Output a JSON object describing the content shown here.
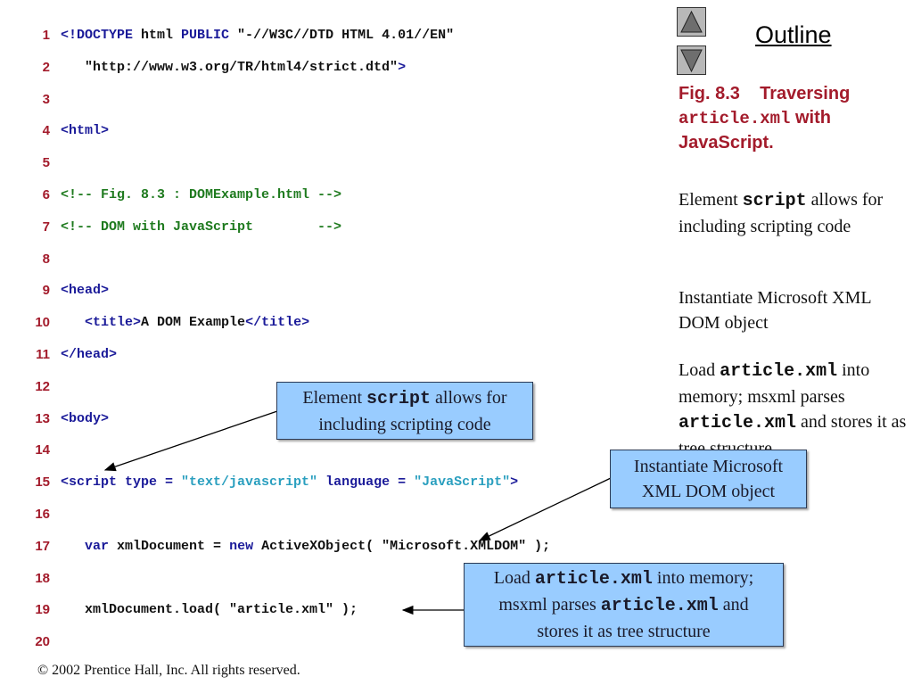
{
  "code_lines": [
    {
      "num": "1",
      "tokens": [
        {
          "cls": "t-tag",
          "text": "<!DOCTYPE"
        },
        {
          "cls": "t-txt",
          "text": " html "
        },
        {
          "cls": "t-tag",
          "text": "PUBLIC"
        },
        {
          "cls": "t-txt",
          "text": " \"-//W3C//DTD HTML 4.01//EN\""
        }
      ]
    },
    {
      "num": "2",
      "tokens": [
        {
          "cls": "t-txt",
          "text": "   \"http://www.w3.org/TR/html4/strict.dtd\""
        },
        {
          "cls": "t-tag",
          "text": ">"
        }
      ]
    },
    {
      "num": "3",
      "tokens": []
    },
    {
      "num": "4",
      "tokens": [
        {
          "cls": "t-tag",
          "text": "<html>"
        }
      ]
    },
    {
      "num": "5",
      "tokens": []
    },
    {
      "num": "6",
      "tokens": [
        {
          "cls": "t-cmt",
          "text": "<!-- Fig. 8.3 : DOMExample.html -->"
        }
      ]
    },
    {
      "num": "7",
      "tokens": [
        {
          "cls": "t-cmt",
          "text": "<!-- DOM with JavaScript        -->"
        }
      ]
    },
    {
      "num": "8",
      "tokens": []
    },
    {
      "num": "9",
      "tokens": [
        {
          "cls": "t-tag",
          "text": "<head>"
        }
      ]
    },
    {
      "num": "10",
      "tokens": [
        {
          "cls": "t-txt",
          "text": "   "
        },
        {
          "cls": "t-tag",
          "text": "<title>"
        },
        {
          "cls": "t-txt",
          "text": "A DOM Example"
        },
        {
          "cls": "t-tag",
          "text": "</title>"
        }
      ]
    },
    {
      "num": "11",
      "tokens": [
        {
          "cls": "t-tag",
          "text": "</head>"
        }
      ]
    },
    {
      "num": "12",
      "tokens": []
    },
    {
      "num": "13",
      "tokens": [
        {
          "cls": "t-tag",
          "text": "<body>"
        }
      ]
    },
    {
      "num": "14",
      "tokens": []
    },
    {
      "num": "15",
      "tokens": [
        {
          "cls": "t-tag",
          "text": "<script type = "
        },
        {
          "cls": "t-str",
          "text": "\"text/javascript\""
        },
        {
          "cls": "t-tag",
          "text": " language = "
        },
        {
          "cls": "t-str",
          "text": "\"JavaScript\""
        },
        {
          "cls": "t-tag",
          "text": ">"
        }
      ]
    },
    {
      "num": "16",
      "tokens": []
    },
    {
      "num": "17",
      "tokens": [
        {
          "cls": "t-txt",
          "text": "   "
        },
        {
          "cls": "t-kw",
          "text": "var"
        },
        {
          "cls": "t-txt",
          "text": " xmlDocument = "
        },
        {
          "cls": "t-kw",
          "text": "new"
        },
        {
          "cls": "t-txt",
          "text": " ActiveXObject( \"Microsoft.XMLDOM\" );"
        }
      ]
    },
    {
      "num": "18",
      "tokens": []
    },
    {
      "num": "19",
      "tokens": [
        {
          "cls": "t-txt",
          "text": "   xmlDocument.load( \"article.xml\" );"
        }
      ]
    },
    {
      "num": "20",
      "tokens": []
    }
  ],
  "sidebar": {
    "outline_label": "Outline",
    "nav_up": "up-arrow",
    "nav_down": "down-arrow",
    "fig_title": {
      "prefix": "Fig. 8.3    Traversing",
      "mono": "article.xml",
      "suffix_1": " with",
      "suffix_2": "JavaScript."
    },
    "notes": [
      {
        "parts": [
          {
            "t": "Element "
          },
          {
            "m": "script"
          },
          {
            "t": " allows for including scripting code"
          }
        ]
      },
      {
        "parts": [
          {
            "t": "Instantiate Microsoft XML DOM object"
          }
        ]
      },
      {
        "parts": [
          {
            "t": "Load "
          },
          {
            "m": "article.xml"
          },
          {
            "t": " into memory; msxml parses "
          },
          {
            "m": "article.xml"
          },
          {
            "t": " and stores it as tree structure"
          }
        ]
      }
    ]
  },
  "callouts": {
    "script": {
      "l1a": "Element ",
      "l1m": "script",
      "l1b": " allows for",
      "l2": "including scripting code"
    },
    "activex": {
      "l1": "Instantiate Microsoft",
      "l2": "XML DOM object"
    },
    "load": {
      "l1a": "Load ",
      "l1m": "article.xml",
      "l1b": " into memory;",
      "l2a": "msxml parses ",
      "l2m": "article.xml",
      "l2b": " and",
      "l3": "stores it as tree structure"
    }
  },
  "colors": {
    "callout_bg": "#99ccff",
    "line_number": "#a31b2b",
    "tag": "#1a1a99",
    "string": "#2a9fbf",
    "comment": "#1e7a1e"
  },
  "footer": "© 2002 Prentice Hall, Inc.  All rights reserved."
}
